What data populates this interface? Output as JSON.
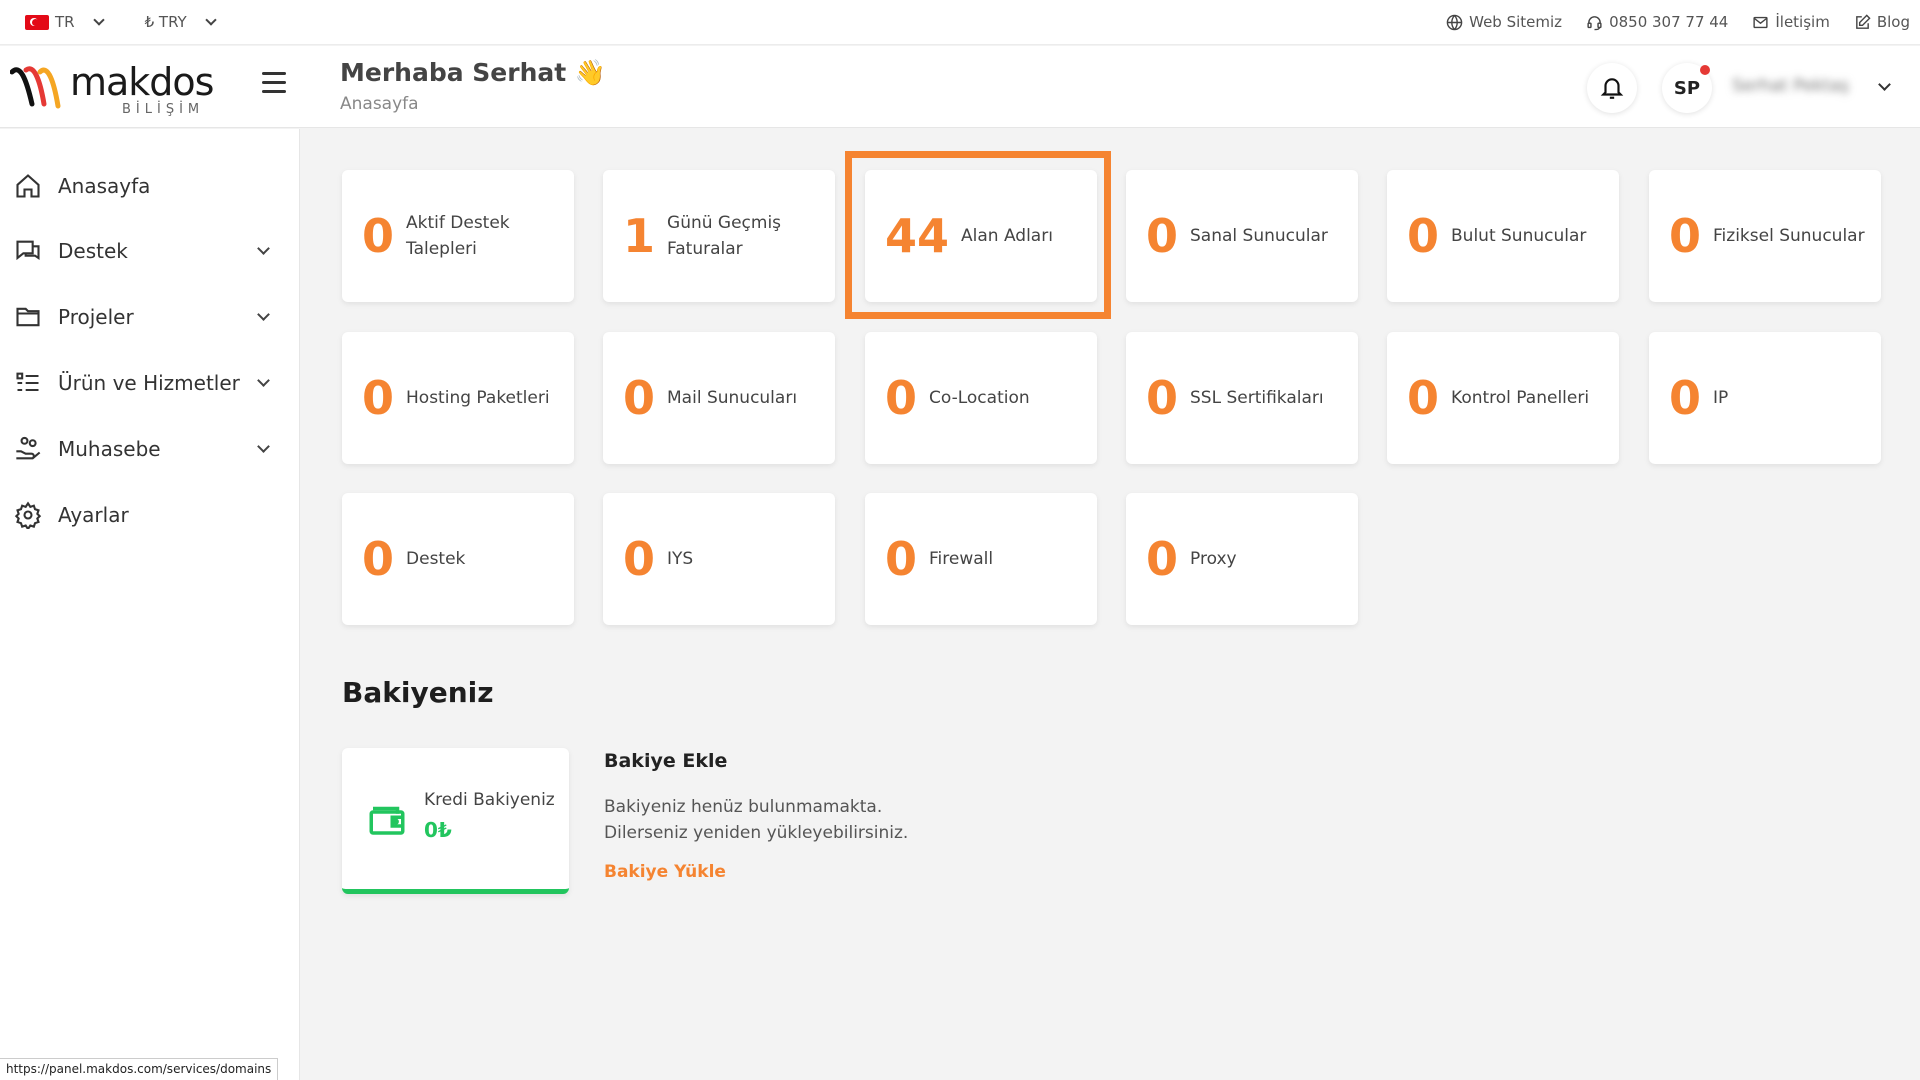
{
  "topbar": {
    "language": "TR",
    "currency": "₺ TRY",
    "links": [
      {
        "label": "Web Sitemiz",
        "icon": "globe-icon"
      },
      {
        "label": "0850 307 77 44",
        "icon": "headset-icon"
      },
      {
        "label": "İletişim",
        "icon": "mail-icon"
      },
      {
        "label": "Blog",
        "icon": "edit-icon"
      }
    ]
  },
  "header": {
    "logo_text": "makdos",
    "logo_sub": "BİLİŞİM",
    "greeting": "Merhaba Serhat 👋",
    "breadcrumb": "Anasayfa",
    "avatar_initials": "SP",
    "username": "Serhat Pektaş"
  },
  "sidebar": {
    "items": [
      {
        "label": "Anasayfa",
        "icon": "home-icon"
      },
      {
        "label": "Destek",
        "icon": "chat-icon"
      },
      {
        "label": "Projeler",
        "icon": "folder-icon"
      },
      {
        "label": "Ürün ve Hizmetler",
        "icon": "list-icon"
      },
      {
        "label": "Muhasebe",
        "icon": "hand-money-icon"
      },
      {
        "label": "Ayarlar",
        "icon": "gear-icon"
      }
    ]
  },
  "cards": [
    {
      "value": "0",
      "label": "Aktif Destek Talepleri"
    },
    {
      "value": "1",
      "label": "Günü Geçmiş Faturalar"
    },
    {
      "value": "44",
      "label": "Alan Adları"
    },
    {
      "value": "0",
      "label": "Sanal Sunucular"
    },
    {
      "value": "0",
      "label": "Bulut Sunucular"
    },
    {
      "value": "0",
      "label": "Fiziksel Sunucular"
    },
    {
      "value": "0",
      "label": "Hosting Paketleri"
    },
    {
      "value": "0",
      "label": "Mail Sunucuları"
    },
    {
      "value": "0",
      "label": "Co-Location"
    },
    {
      "value": "0",
      "label": "SSL Sertifikaları"
    },
    {
      "value": "0",
      "label": "Kontrol Panelleri"
    },
    {
      "value": "0",
      "label": "IP"
    },
    {
      "value": "0",
      "label": "Destek"
    },
    {
      "value": "0",
      "label": "IYS"
    },
    {
      "value": "0",
      "label": "Firewall"
    },
    {
      "value": "0",
      "label": "Proxy"
    }
  ],
  "balance": {
    "title": "Bakiyeniz",
    "credit_label": "Kredi Bakiyeniz",
    "credit_value": "0₺",
    "add_title": "Bakiye Ekle",
    "add_desc_1": "Bakiyeniz henüz bulunmamakta.",
    "add_desc_2": "Dilerseniz yeniden yükleyebilirsiniz.",
    "add_link": "Bakiye Yükle"
  },
  "status_url": "https://panel.makdos.com/services/domains",
  "colors": {
    "accent": "#f58431",
    "success": "#22c55e"
  }
}
